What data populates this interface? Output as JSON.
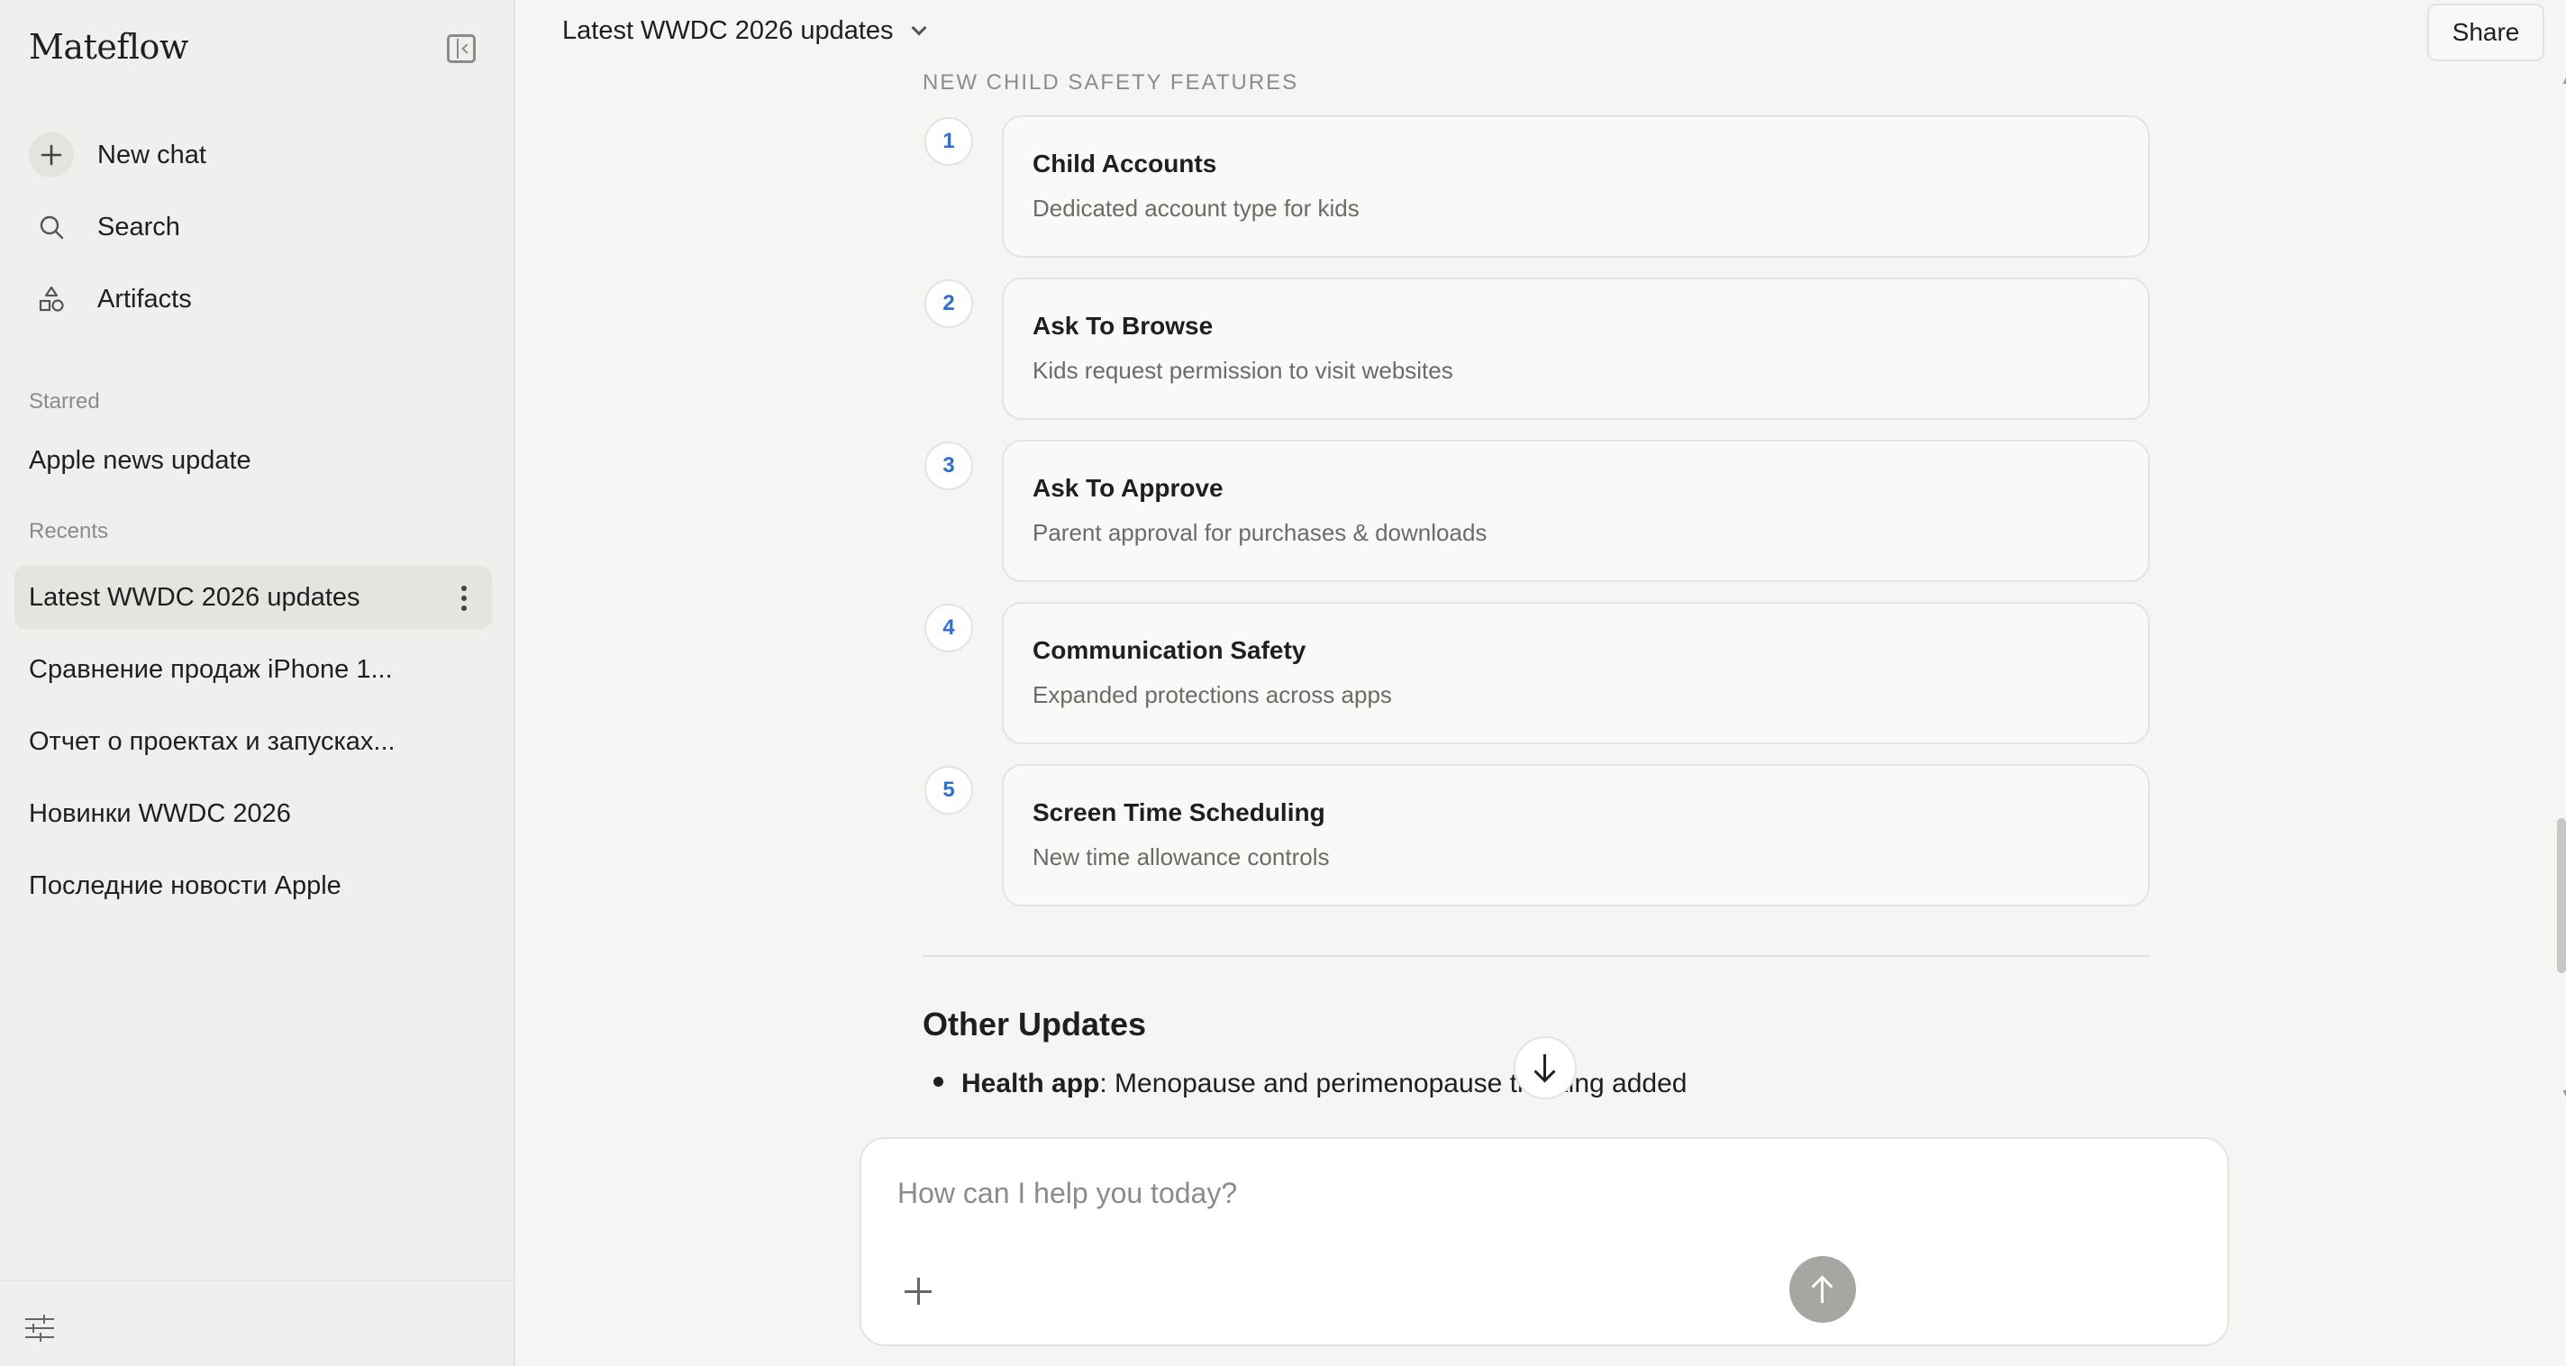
{
  "app": {
    "name": "Mateflow"
  },
  "sidebar": {
    "nav": [
      {
        "label": "New chat",
        "icon": "plus-icon"
      },
      {
        "label": "Search",
        "icon": "search-icon"
      },
      {
        "label": "Artifacts",
        "icon": "artifacts-icon"
      }
    ],
    "starred_label": "Starred",
    "starred": [
      {
        "label": "Apple news update"
      }
    ],
    "recents_label": "Recents",
    "recents": [
      {
        "label": "Latest WWDC 2026 updates",
        "active": true
      },
      {
        "label": "Сравнение продаж iPhone 1..."
      },
      {
        "label": "Отчет о проектах и запусках..."
      },
      {
        "label": "Новинки WWDC 2026"
      },
      {
        "label": "Последние новости Apple"
      }
    ]
  },
  "header": {
    "chat_title": "Latest WWDC 2026 updates",
    "share_label": "Share"
  },
  "content": {
    "section_heading": "NEW CHILD SAFETY FEATURES",
    "features": [
      {
        "num": "1",
        "title": "Child Accounts",
        "desc": "Dedicated account type for kids"
      },
      {
        "num": "2",
        "title": "Ask To Browse",
        "desc": "Kids request permission to visit websites"
      },
      {
        "num": "3",
        "title": "Ask To Approve",
        "desc": "Parent approval for purchases & downloads"
      },
      {
        "num": "4",
        "title": "Communication Safety",
        "desc": "Expanded protections across apps"
      },
      {
        "num": "5",
        "title": "Screen Time Scheduling",
        "desc": "New time allowance controls"
      }
    ],
    "other_heading": "Other Updates",
    "bullets": [
      {
        "bold": "Health app",
        "text": ": Menopause and perimenopause tracking added"
      }
    ]
  },
  "composer": {
    "placeholder": "How can I help you today?"
  },
  "colors": {
    "accent_number": "#2f6fd1",
    "send_button": "#a6a6a3",
    "sidebar_bg": "#efefed"
  }
}
